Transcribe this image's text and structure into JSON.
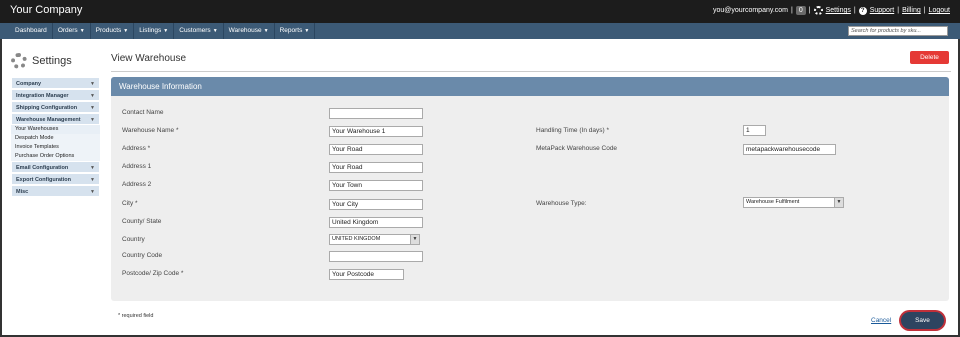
{
  "topbar": {
    "brand": "Your Company",
    "email": "you@yourcompany.com",
    "separator": "|",
    "badge": "0",
    "settings": "Settings",
    "support": "Support",
    "billing": "Billing",
    "logout": "Logout"
  },
  "nav": {
    "items": [
      {
        "label": "Dashboard"
      },
      {
        "label": "Orders"
      },
      {
        "label": "Products"
      },
      {
        "label": "Listings"
      },
      {
        "label": "Customers"
      },
      {
        "label": "Warehouse"
      },
      {
        "label": "Reports"
      }
    ],
    "search_placeholder": "Search for products by sku..."
  },
  "sidebar": {
    "title": "Settings",
    "items": [
      {
        "label": "Company"
      },
      {
        "label": "Integration Manager"
      },
      {
        "label": "Shipping Configuration"
      },
      {
        "label": "Warehouse Management"
      },
      {
        "label": "Your Warehouses"
      },
      {
        "label": "Despatch Mode"
      },
      {
        "label": "Invoice Templates"
      },
      {
        "label": "Purchase Order Options"
      },
      {
        "label": "Email Configuration"
      },
      {
        "label": "Export Configuration"
      },
      {
        "label": "Misc"
      }
    ]
  },
  "main": {
    "title": "View Warehouse",
    "delete_label": "Delete",
    "panel_title": "Warehouse Information",
    "fields": {
      "contact_name": {
        "label": "Contact Name",
        "value": ""
      },
      "warehouse_name": {
        "label": "Warehouse Name *",
        "value": "Your Warehouse 1"
      },
      "address": {
        "label": "Address *",
        "value": "Your Road"
      },
      "address1": {
        "label": "Address 1",
        "value": "Your Road"
      },
      "address2": {
        "label": "Address 2",
        "value": "Your Town"
      },
      "city": {
        "label": "City *",
        "value": "Your City"
      },
      "county": {
        "label": "County/ State",
        "value": "United Kingdom"
      },
      "country": {
        "label": "Country",
        "value": "UNITED KINGDOM"
      },
      "country_code": {
        "label": "Country Code",
        "value": ""
      },
      "postcode": {
        "label": "Postcode/ Zip Code *",
        "value": "Your Postcode"
      },
      "handling_time": {
        "label": "Handling Time (In days) *",
        "value": "1"
      },
      "metapack_code": {
        "label": "MetaPack Warehouse Code",
        "value": "metapackwarehousecode"
      },
      "warehouse_type": {
        "label": "Warehouse Type:",
        "value": "Warehouse Fulfilment"
      }
    },
    "required_note": "* required field",
    "cancel_label": "Cancel",
    "save_label": "Save"
  },
  "colors": {
    "topbar": "#1c1c1c",
    "navbar": "#3c5a76",
    "panel_header": "#6a8aaa",
    "delete": "#e53935",
    "save": "#2e4460",
    "save_outline": "#c0303a"
  }
}
